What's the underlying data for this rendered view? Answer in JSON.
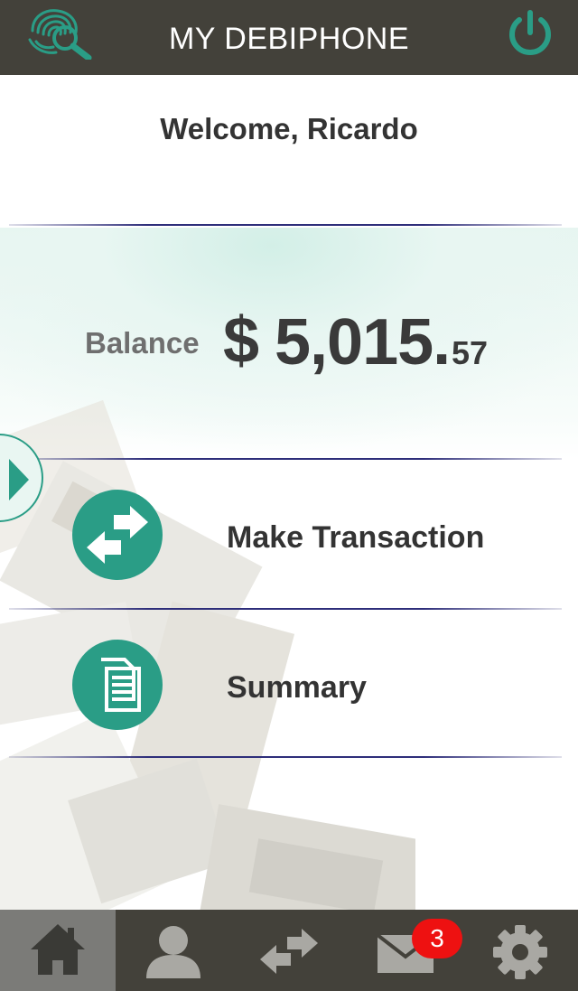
{
  "header": {
    "title": "MY DEBIPHONE",
    "logo_icon": "fingerprint-magnifier-logo",
    "power_icon": "power-icon",
    "accent_color": "#2a9d86",
    "bar_color": "#43413a"
  },
  "welcome": {
    "text": "Welcome, Ricardo"
  },
  "balance": {
    "label": "Balance",
    "currency": "$",
    "whole": "5,015.",
    "cents": "57"
  },
  "menu": [
    {
      "label": "Make Transaction",
      "icon": "transfer-arrows-icon"
    },
    {
      "label": "Summary",
      "icon": "documents-icon"
    }
  ],
  "side_tab": {
    "icon": "chevron-right-icon"
  },
  "tabbar": {
    "tabs": [
      {
        "id": "home",
        "icon": "home-icon",
        "active": true
      },
      {
        "id": "profile",
        "icon": "user-icon",
        "active": false
      },
      {
        "id": "transfer",
        "icon": "transfer-arrows-icon",
        "active": false
      },
      {
        "id": "messages",
        "icon": "mail-icon",
        "active": false,
        "badge": "3"
      },
      {
        "id": "settings",
        "icon": "gear-icon",
        "active": false
      }
    ],
    "badge_color": "#ee1111"
  }
}
